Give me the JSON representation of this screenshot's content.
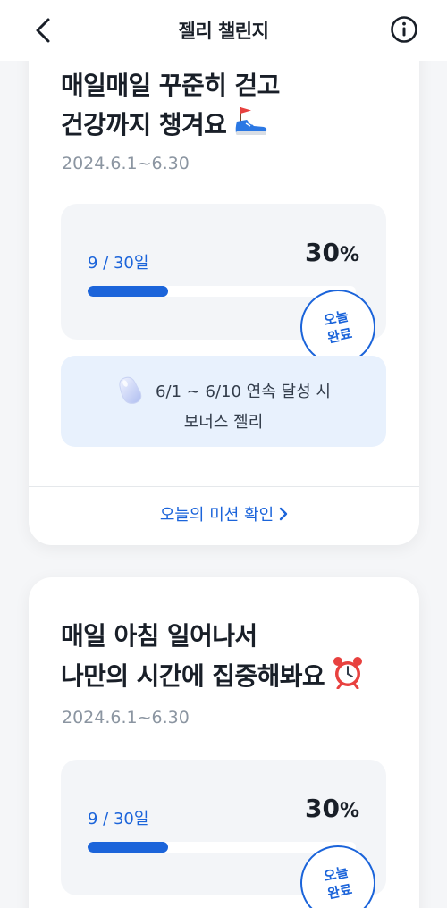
{
  "header": {
    "title": "젤리 챌린지",
    "back_icon": "chevron-left-icon",
    "info_icon": "info-circle-icon"
  },
  "challenges": [
    {
      "title_line1": "매일매일 꾸준히 걷고",
      "title_line2": "건강까지 챙겨요",
      "emoji_icon": "sneaker-with-flag-icon",
      "date_range": "2024.6.1~6.30",
      "days_progress": "9 / 30일",
      "percent_value": "30",
      "percent_sign": "%",
      "progress_fraction": 0.3,
      "stamp_line1": "오늘",
      "stamp_line2": "완료",
      "bonus_text_line1": "6/1 ~ 6/10 연속 달성 시",
      "bonus_text_line2": "보너스 젤리",
      "bonus_icon": "jelly-bean-icon",
      "mission_link": "오늘의 미션 확인"
    },
    {
      "title_line1": "매일 아침 일어나서",
      "title_line2": "나만의 시간에 집중해봐요",
      "emoji_icon": "alarm-clock-icon",
      "date_range": "2024.6.1~6.30",
      "days_progress": "9 / 30일",
      "percent_value": "30",
      "percent_sign": "%",
      "progress_fraction": 0.3,
      "stamp_line1": "오늘",
      "stamp_line2": "완료"
    }
  ],
  "colors": {
    "accent": "#1b64da",
    "background": "#f5f6f8",
    "card": "#ffffff",
    "progress_box": "#f3f5f8",
    "bonus_box": "#e8f1fd",
    "muted_text": "#8b95a1"
  }
}
